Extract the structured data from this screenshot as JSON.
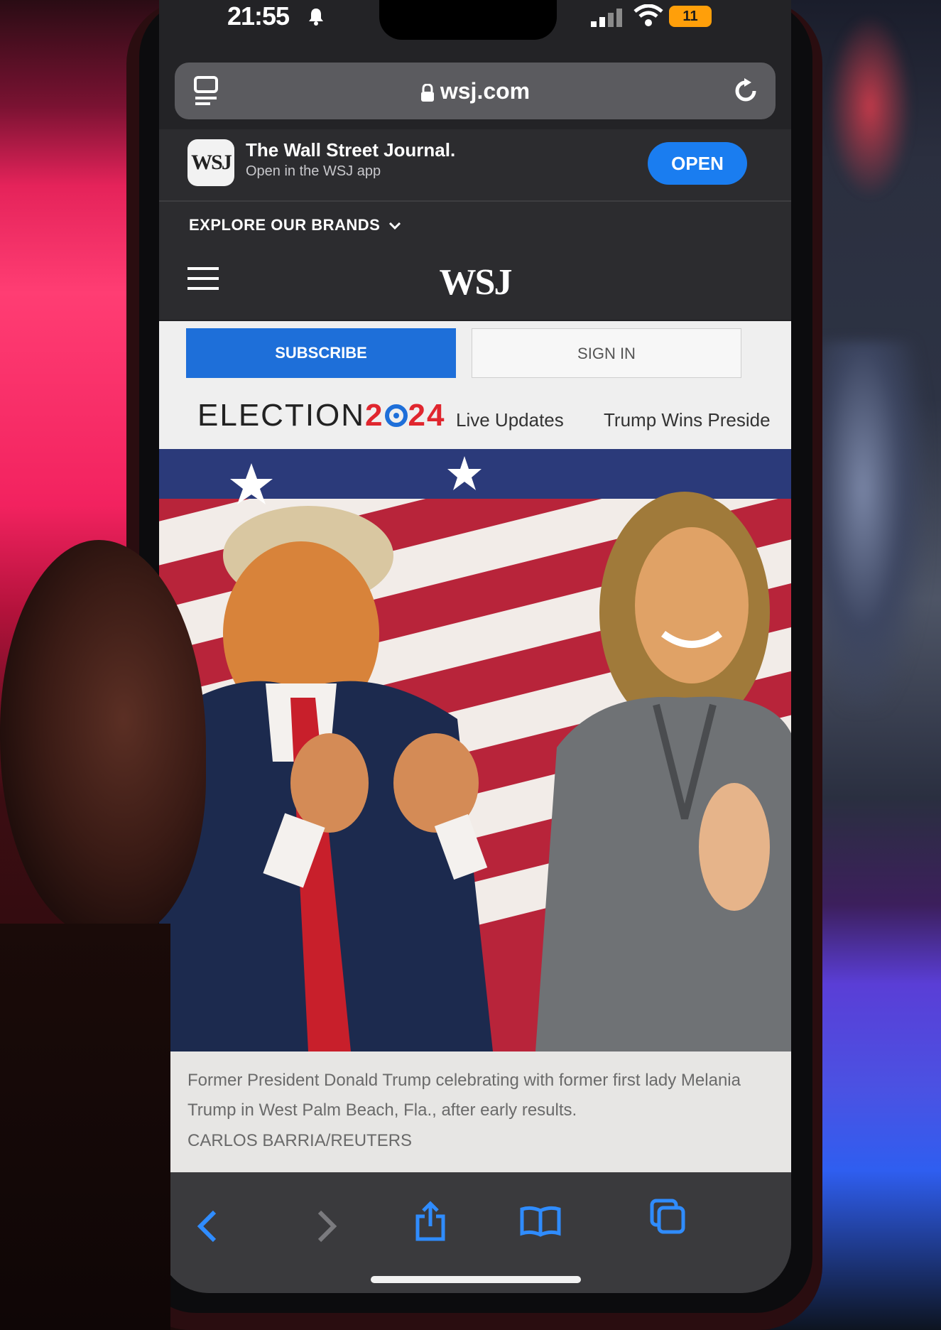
{
  "status_bar": {
    "time": "21:55",
    "battery": "11"
  },
  "browser": {
    "url": "wsj.com"
  },
  "app_banner": {
    "logo_text": "WSJ",
    "name": "The Wall Street Journal.",
    "subtitle": "Open in the WSJ app",
    "open_label": "OPEN"
  },
  "explore": {
    "label": "EXPLORE OUR BRANDS"
  },
  "header": {
    "logo": "WSJ"
  },
  "auth": {
    "subscribe_label": "SUBSCRIBE",
    "signin_label": "SIGN IN"
  },
  "election": {
    "title_prefix": "ELECTION",
    "year_part1": "2",
    "year_part2": "24",
    "links": [
      "Live Updates",
      "Trump Wins Preside"
    ]
  },
  "caption": {
    "text": "Former President Donald Trump celebrating with former first lady Melania Trump in West Palm Beach, Fla., after early results.",
    "credit": "CARLOS BARRIA/REUTERS"
  },
  "colors": {
    "accent_blue": "#1e6fd9",
    "open_button": "#1a7df0",
    "election_red": "#e0262e",
    "safari_icon_blue": "#2f8cff"
  },
  "icons": [
    "bell-icon",
    "signal-icon",
    "wifi-icon",
    "battery-icon",
    "tabs-icon",
    "lock-icon",
    "reload-icon",
    "chevron-down-icon",
    "menu-icon",
    "back-icon",
    "forward-icon",
    "share-icon",
    "bookmarks-icon",
    "tabs-overview-icon"
  ]
}
